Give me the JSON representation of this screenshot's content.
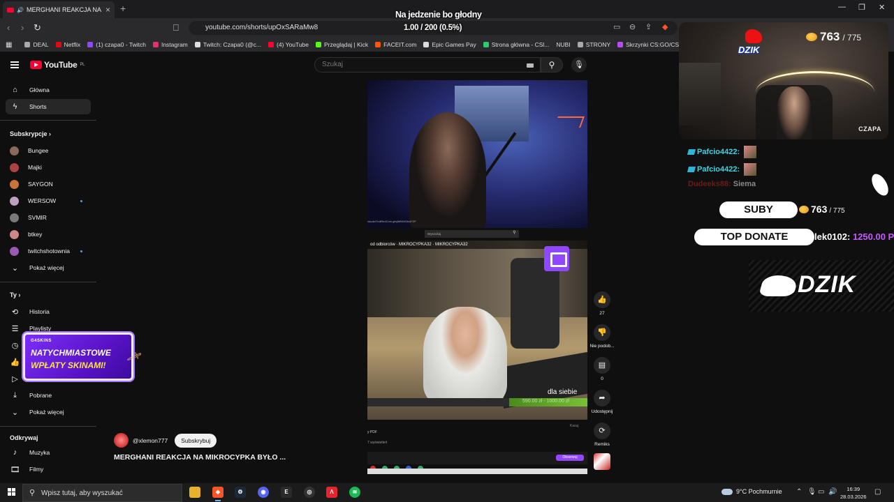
{
  "browser": {
    "tab_title": "MERGHANI REAKCJA NA MIKR",
    "url": "youtube.com/shorts/upOxSARaMw8",
    "bookmarks": [
      {
        "label": "DEAL",
        "color": "#aaaaaa"
      },
      {
        "label": "Netflix",
        "color": "#e50914"
      },
      {
        "label": "(1) czapa0 - Twitch",
        "color": "#9146ff"
      },
      {
        "label": "Instagram",
        "color": "#e1306c"
      },
      {
        "label": "Twitch: Czapa0 (@c...",
        "color": "#dddddd"
      },
      {
        "label": "(4) YouTube",
        "color": "#ff0033"
      },
      {
        "label": "Przeglądaj | Kick",
        "color": "#53fc18"
      },
      {
        "label": "FACEIT.com",
        "color": "#ff5500"
      },
      {
        "label": "Epic Games Pay",
        "color": "#dddddd"
      },
      {
        "label": "Strona główna - CSl...",
        "color": "#2ecc71"
      },
      {
        "label": "NUBI",
        "color": "#888888"
      },
      {
        "label": "STRONY",
        "color": "#aaaaaa"
      },
      {
        "label": "Skrzynki CS:GO/CS...",
        "color": "#b44cff"
      }
    ]
  },
  "youtube": {
    "logo_text": "YouTube",
    "logo_region": "PL",
    "search_placeholder": "Szukaj",
    "nav": [
      {
        "label": "Główna",
        "icon": "home-icon"
      },
      {
        "label": "Shorts",
        "icon": "shorts-icon"
      }
    ],
    "subscriptions_title": "Subskrypcje",
    "subscriptions": [
      {
        "label": "Bungee",
        "color": "#8a6a5a",
        "live": false
      },
      {
        "label": "Majki",
        "color": "#a44",
        "live": false
      },
      {
        "label": "SAYGON",
        "color": "#c8743b",
        "live": false
      },
      {
        "label": "WERSOW",
        "color": "#c0a0c0",
        "live": true
      },
      {
        "label": "SVMIR",
        "color": "#7a7a7a",
        "live": false
      },
      {
        "label": "btkey",
        "color": "#c88",
        "live": false
      },
      {
        "label": "twitchshotownia",
        "color": "#9b59b6",
        "live": true
      }
    ],
    "show_more": "Pokaż więcej",
    "you_title": "Ty",
    "you_items": [
      {
        "label": "Historia",
        "icon": "history-icon"
      },
      {
        "label": "Playlisty",
        "icon": "playlist-icon"
      },
      {
        "label": "",
        "icon": "clock-icon"
      },
      {
        "label": "",
        "icon": "like-icon"
      },
      {
        "label": "Twoje filmy",
        "icon": "video-icon"
      },
      {
        "label": "Pobrane",
        "icon": "download-icon"
      }
    ],
    "explore_title": "Odkrywaj",
    "explore": [
      {
        "label": "Muzyka",
        "icon": "music-icon"
      },
      {
        "label": "Filmy",
        "icon": "movie-icon"
      }
    ],
    "promo": {
      "brand": "G4SKINS",
      "line1": "NATYCHMIASTOWE",
      "line2": "WPŁATY SKINAMI!"
    },
    "short": {
      "channel": "@xlemon777",
      "subscribe": "Subskrybuj",
      "title": "MERGHANI REAKCJA NA MIKROCYPKA BYŁO ...",
      "likes": "27",
      "dislike_label": "Nie podob...",
      "comments": "0",
      "share_label": "Udostępnij",
      "remix_label": "Remiks",
      "overlay_small_search": "Wyszukaj",
      "overlay_streamers": "od odbiorców  · MIKROCYPKA32 · MIKROCYPKA32",
      "overlay_dla_siebie": "dla siebie",
      "overlay_goal": "590.00 zł - 1000.00 zł",
      "overlay_pdf": "y PDF",
      "overlay_views": "7 wyświetleń",
      "overlay_kasuj": "Kasuj",
      "overlay_obserwuj": "Obserwuj",
      "overlay_url": "/studioTrollRedCoin-gfnjIMNWGbcIF2P"
    }
  },
  "stream_overlay": {
    "title": "Na jedzenie bo głodny",
    "goal": "1.00 / 200 (0.5%)",
    "cam_name": "CZAPA",
    "logo": "DZIK",
    "subs_current": "763",
    "subs_total": "/ 775",
    "chat": [
      {
        "user": "Pafcio4422:",
        "color": "#3ad6e6"
      },
      {
        "user": "Pafcio4422:",
        "color": "#3ad6e6"
      },
      {
        "user": "Dudeeks88:",
        "color": "#7a1a1a",
        "msg": "Siema"
      }
    ],
    "suby_label": "SUBY",
    "top_donate_label": "TOP DONATE",
    "top_donor": "lek0102:",
    "top_donate_amount": "1250.00 P"
  },
  "taskbar": {
    "search_placeholder": "Wpisz tutaj, aby wyszukać",
    "weather": "9°C  Pochmurnie",
    "time": "16:39",
    "date": "28.03.2026"
  },
  "colors": {
    "yt_red": "#ff0033",
    "twitch_purple": "#9146ff",
    "background": "#0f0f0f"
  }
}
